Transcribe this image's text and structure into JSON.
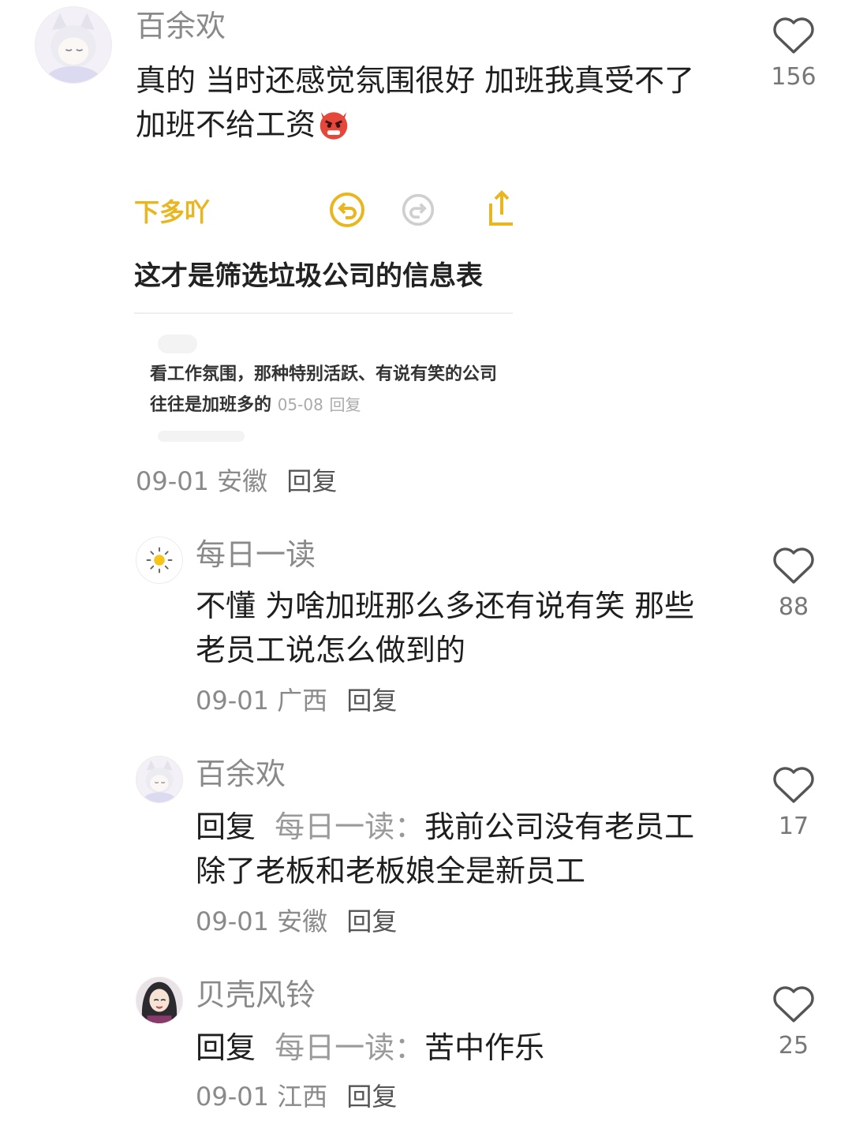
{
  "comment1": {
    "username": "百余欢",
    "text": "真的 当时还感觉氛围很好 加班我真受不了 加班不给工资",
    "emoji_icon": "angry-devil-emoji",
    "date": "09-01",
    "location": "安徽",
    "reply_label": "回复",
    "likes": "156",
    "screenshot": {
      "top_text": "下多吖",
      "title": "这才是筛选垃圾公司的信息表",
      "comment_text": "看工作氛围，那种特别活跃、有说有笑的公司往往是加班多的",
      "comment_date": "05-08",
      "comment_reply": "回复"
    }
  },
  "comment2": {
    "username": "每日一读",
    "text": "不懂 为啥加班那么多还有说有笑 那些老员工说怎么做到的",
    "date": "09-01",
    "location": "广西",
    "reply_label": "回复",
    "likes": "88"
  },
  "comment3": {
    "username": "百余欢",
    "reply_prefix": "回复",
    "reply_to": "每日一读：",
    "text": "我前公司没有老员工 除了老板和老板娘全是新员工",
    "date": "09-01",
    "location": "安徽",
    "reply_label": "回复",
    "likes": "17"
  },
  "comment4": {
    "username": "贝壳风铃",
    "reply_prefix": "回复",
    "reply_to": "每日一读：",
    "text": "苦中作乐",
    "date": "09-01",
    "location": "江西",
    "reply_label": "回复",
    "likes": "25"
  },
  "colors": {
    "accent_yellow": "#e9b620",
    "name_gray": "#8a8a8a"
  }
}
